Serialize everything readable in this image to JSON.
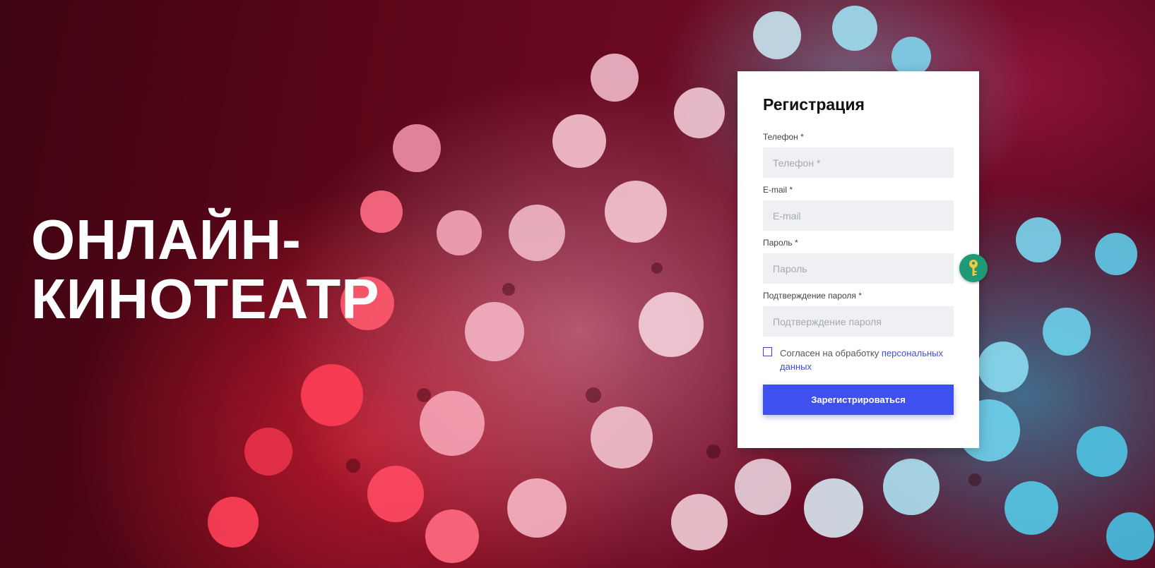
{
  "hero": {
    "line1": "ОНЛАЙН-",
    "line2": "КИНОТЕАТР"
  },
  "form": {
    "title": "Регистрация",
    "fields": [
      {
        "label": "Телефон *",
        "placeholder": "Телефон *",
        "value": ""
      },
      {
        "label": "E-mail *",
        "placeholder": "E-mail",
        "value": ""
      },
      {
        "label": "Пароль *",
        "placeholder": "Пароль",
        "value": ""
      },
      {
        "label": "Подтверждение пароля *",
        "placeholder": "Подтверждение пароля",
        "value": ""
      }
    ],
    "consent": {
      "checked": false,
      "text": "Согласен на обработку ",
      "link": "персональных данных"
    },
    "submit_label": "Зарегистрироваться"
  },
  "icons": {
    "password_manager": "key-icon",
    "background": "popcorn-photo"
  },
  "colors": {
    "accent": "#3f50f0",
    "link": "#3f4fd8",
    "key_badge": "#1f9a76",
    "background_dark": "#5b0618"
  }
}
